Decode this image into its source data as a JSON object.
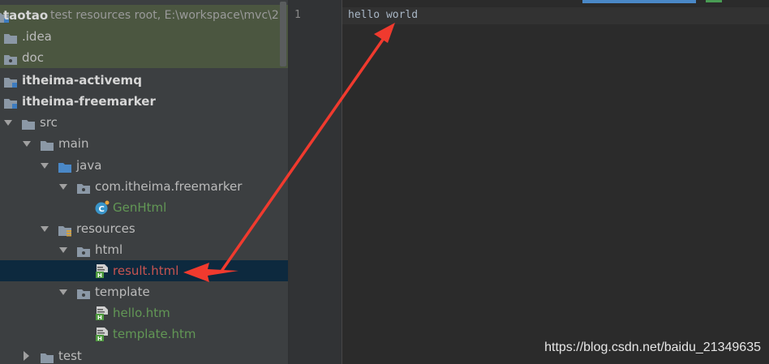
{
  "project_tree": {
    "root": {
      "name": "taotao",
      "description": "test resources root,  E:\\workspace\\mvc\\2"
    },
    "items": [
      {
        "label": ".idea"
      },
      {
        "label": "doc"
      },
      {
        "label": "itheima-activemq"
      },
      {
        "label": "itheima-freemarker"
      },
      {
        "label": "src"
      },
      {
        "label": "main"
      },
      {
        "label": "java"
      },
      {
        "label": "com.itheima.freemarker"
      },
      {
        "label": "GenHtml"
      },
      {
        "label": "resources"
      },
      {
        "label": "html"
      },
      {
        "label": "result.html"
      },
      {
        "label": "template"
      },
      {
        "label": "hello.htm"
      },
      {
        "label": "template.htm"
      },
      {
        "label": "test"
      }
    ]
  },
  "editor": {
    "line_number": "1",
    "code": "hello world"
  },
  "watermark": "https://blog.csdn.net/baidu_21349635",
  "colors": {
    "panel_bg": "#3c3f41",
    "editor_bg": "#2b2b2b",
    "selection_bg": "#0d293e",
    "green_text": "#629755",
    "red_text": "#c75450",
    "annotation_arrow": "#f03a2e"
  }
}
